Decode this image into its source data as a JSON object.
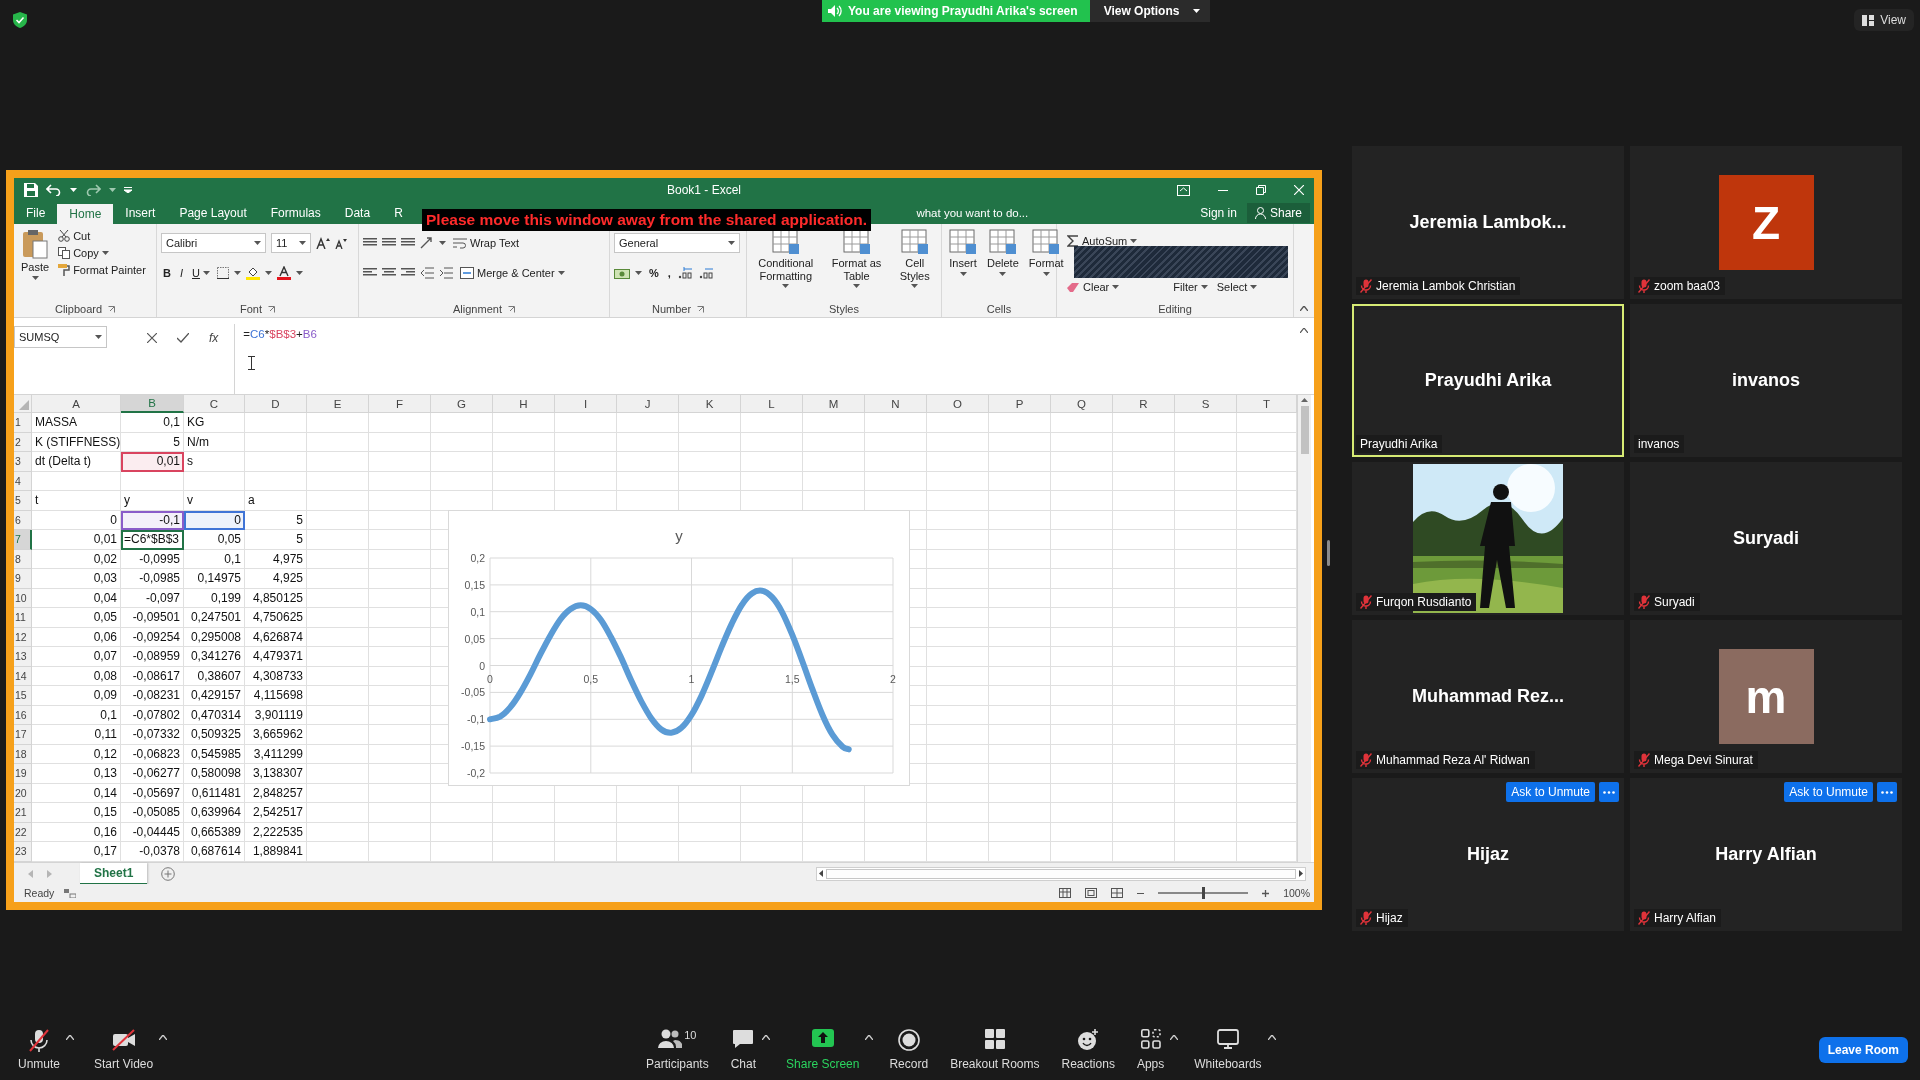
{
  "banner": {
    "text": "You are viewing Prayudhi Arika's screen",
    "button": "View Options"
  },
  "view_button": "View",
  "excel": {
    "title": "Book1 - Excel",
    "tabs": [
      {
        "label": "File",
        "selected": false
      },
      {
        "label": "Home",
        "selected": true
      },
      {
        "label": "Insert",
        "selected": false
      },
      {
        "label": "Page Layout",
        "selected": false
      },
      {
        "label": "Formulas",
        "selected": false
      },
      {
        "label": "Data",
        "selected": false
      },
      {
        "label": "R",
        "selected": false
      }
    ],
    "tell_me": "what you want to do...",
    "sign_in": "Sign in",
    "share": "Share",
    "warning": "Please move this window away from the shared application.",
    "ribbon": [
      {
        "kind": "clipboard",
        "label": "Clipboard",
        "paste": "Paste",
        "items": [
          "Cut",
          "Copy",
          "Format Painter"
        ]
      },
      {
        "kind": "font",
        "label": "Font",
        "font_name": "Calibri",
        "font_size": "11",
        "styles": [
          "B",
          "I",
          "U"
        ]
      },
      {
        "kind": "alignment",
        "label": "Alignment",
        "items": [
          "Wrap Text",
          "Merge & Center"
        ]
      },
      {
        "kind": "number",
        "label": "Number",
        "format": "General",
        "symbols": [
          "%",
          ","
        ]
      },
      {
        "kind": "large_buttons",
        "label": "Styles",
        "items": [
          "Conditional\nFormatting",
          "Format as\nTable",
          "Cell\nStyles"
        ]
      },
      {
        "kind": "large_buttons",
        "label": "Cells",
        "items": [
          "Insert",
          "Delete",
          "Format"
        ]
      },
      {
        "kind": "editing",
        "label": "Editing",
        "items": [
          "AutoSum",
          "Clear",
          "Filter",
          "Select"
        ]
      }
    ],
    "name_box": "SUMSQ",
    "function_button": "fx",
    "formula": [
      {
        "text": "="
      },
      {
        "text": "C6",
        "color": "#3f74d6"
      },
      {
        "text": "*"
      },
      {
        "text": "$B$3",
        "color": "#d9445f"
      },
      {
        "text": "+"
      },
      {
        "text": "B6",
        "color": "#8a5cc9"
      }
    ],
    "columns": [
      {
        "label": "A",
        "selected": false
      },
      {
        "label": "B",
        "selected": true
      },
      {
        "label": "C",
        "selected": false
      },
      {
        "label": "D",
        "selected": false
      },
      {
        "label": "E",
        "selected": false
      },
      {
        "label": "F",
        "selected": false
      },
      {
        "label": "G",
        "selected": false
      },
      {
        "label": "H",
        "selected": false
      },
      {
        "label": "I",
        "selected": false
      },
      {
        "label": "J",
        "selected": false
      },
      {
        "label": "K",
        "selected": false
      },
      {
        "label": "L",
        "selected": false
      },
      {
        "label": "M",
        "selected": false
      },
      {
        "label": "N",
        "selected": false
      },
      {
        "label": "O",
        "selected": false
      },
      {
        "label": "P",
        "selected": false
      },
      {
        "label": "Q",
        "selected": false
      },
      {
        "label": "R",
        "selected": false
      },
      {
        "label": "S",
        "selected": false
      },
      {
        "label": "T",
        "selected": false
      }
    ],
    "rows": [
      {
        "number": "1",
        "selected": false,
        "cells": [
          {
            "text": "MASSA",
            "kind": "text"
          },
          {
            "text": "0,1",
            "kind": "number"
          },
          {
            "text": "KG",
            "kind": "text"
          }
        ]
      },
      {
        "number": "2",
        "selected": false,
        "cells": [
          {
            "text": "K (STIFFNESS)",
            "kind": "text"
          },
          {
            "text": "5",
            "kind": "number"
          },
          {
            "text": "N/m",
            "kind": "text"
          }
        ]
      },
      {
        "number": "3",
        "selected": false,
        "cells": [
          {
            "text": "dt (Delta t)",
            "kind": "text"
          },
          {
            "text": "0,01",
            "kind": "number",
            "color": "#d9445f"
          },
          {
            "text": "s",
            "kind": "text"
          }
        ]
      },
      {
        "number": "4",
        "selected": false
      },
      {
        "number": "5",
        "selected": false,
        "cells": [
          {
            "text": "t",
            "kind": "text"
          },
          {
            "text": "y",
            "kind": "text"
          },
          {
            "text": "v",
            "kind": "text"
          },
          {
            "text": "a",
            "kind": "text"
          }
        ]
      },
      {
        "number": "6",
        "selected": false,
        "cells": [
          {
            "text": "0",
            "kind": "number"
          },
          {
            "text": "-0,1",
            "kind": "number",
            "color": "#8a5cc9"
          },
          {
            "text": "0",
            "kind": "number",
            "color": "#3f74d6"
          },
          {
            "text": "5",
            "kind": "number"
          }
        ]
      },
      {
        "number": "7",
        "selected": true,
        "cells": [
          {
            "text": "0,01",
            "kind": "number"
          },
          {
            "text": "=C6*$B$3",
            "kind": "editing"
          },
          {
            "text": "0,05",
            "kind": "number"
          },
          {
            "text": "5",
            "kind": "number"
          }
        ]
      },
      {
        "number": "8",
        "selected": false,
        "cells": [
          {
            "text": "0,02",
            "kind": "number"
          },
          {
            "text": "-0,0995",
            "kind": "number"
          },
          {
            "text": "0,1",
            "kind": "number"
          },
          {
            "text": "4,975",
            "kind": "number"
          }
        ]
      },
      {
        "number": "9",
        "selected": false,
        "cells": [
          {
            "text": "0,03",
            "kind": "number"
          },
          {
            "text": "-0,0985",
            "kind": "number"
          },
          {
            "text": "0,14975",
            "kind": "number"
          },
          {
            "text": "4,925",
            "kind": "number"
          }
        ]
      },
      {
        "number": "10",
        "selected": false,
        "cells": [
          {
            "text": "0,04",
            "kind": "number"
          },
          {
            "text": "-0,097",
            "kind": "number"
          },
          {
            "text": "0,199",
            "kind": "number"
          },
          {
            "text": "4,850125",
            "kind": "number"
          }
        ]
      },
      {
        "number": "11",
        "selected": false,
        "cells": [
          {
            "text": "0,05",
            "kind": "number"
          },
          {
            "text": "-0,09501",
            "kind": "number"
          },
          {
            "text": "0,247501",
            "kind": "number"
          },
          {
            "text": "4,750625",
            "kind": "number"
          }
        ]
      },
      {
        "number": "12",
        "selected": false,
        "cells": [
          {
            "text": "0,06",
            "kind": "number"
          },
          {
            "text": "-0,09254",
            "kind": "number"
          },
          {
            "text": "0,295008",
            "kind": "number"
          },
          {
            "text": "4,626874",
            "kind": "number"
          }
        ]
      },
      {
        "number": "13",
        "selected": false,
        "cells": [
          {
            "text": "0,07",
            "kind": "number"
          },
          {
            "text": "-0,08959",
            "kind": "number"
          },
          {
            "text": "0,341276",
            "kind": "number"
          },
          {
            "text": "4,479371",
            "kind": "number"
          }
        ]
      },
      {
        "number": "14",
        "selected": false,
        "cells": [
          {
            "text": "0,08",
            "kind": "number"
          },
          {
            "text": "-0,08617",
            "kind": "number"
          },
          {
            "text": "0,38607",
            "kind": "number"
          },
          {
            "text": "4,308733",
            "kind": "number"
          }
        ]
      },
      {
        "number": "15",
        "selected": false,
        "cells": [
          {
            "text": "0,09",
            "kind": "number"
          },
          {
            "text": "-0,08231",
            "kind": "number"
          },
          {
            "text": "0,429157",
            "kind": "number"
          },
          {
            "text": "4,115698",
            "kind": "number"
          }
        ]
      },
      {
        "number": "16",
        "selected": false,
        "cells": [
          {
            "text": "0,1",
            "kind": "number"
          },
          {
            "text": "-0,07802",
            "kind": "number"
          },
          {
            "text": "0,470314",
            "kind": "number"
          },
          {
            "text": "3,901119",
            "kind": "number"
          }
        ]
      },
      {
        "number": "17",
        "selected": false,
        "cells": [
          {
            "text": "0,11",
            "kind": "number"
          },
          {
            "text": "-0,07332",
            "kind": "number"
          },
          {
            "text": "0,509325",
            "kind": "number"
          },
          {
            "text": "3,665962",
            "kind": "number"
          }
        ]
      },
      {
        "number": "18",
        "selected": false,
        "cells": [
          {
            "text": "0,12",
            "kind": "number"
          },
          {
            "text": "-0,06823",
            "kind": "number"
          },
          {
            "text": "0,545985",
            "kind": "number"
          },
          {
            "text": "3,411299",
            "kind": "number"
          }
        ]
      },
      {
        "number": "19",
        "selected": false,
        "cells": [
          {
            "text": "0,13",
            "kind": "number"
          },
          {
            "text": "-0,06277",
            "kind": "number"
          },
          {
            "text": "0,580098",
            "kind": "number"
          },
          {
            "text": "3,138307",
            "kind": "number"
          }
        ]
      },
      {
        "number": "20",
        "selected": false,
        "cells": [
          {
            "text": "0,14",
            "kind": "number"
          },
          {
            "text": "-0,05697",
            "kind": "number"
          },
          {
            "text": "0,611481",
            "kind": "number"
          },
          {
            "text": "2,848257",
            "kind": "number"
          }
        ]
      },
      {
        "number": "21",
        "selected": false,
        "cells": [
          {
            "text": "0,15",
            "kind": "number"
          },
          {
            "text": "-0,05085",
            "kind": "number"
          },
          {
            "text": "0,639964",
            "kind": "number"
          },
          {
            "text": "2,542517",
            "kind": "number"
          }
        ]
      },
      {
        "number": "22",
        "selected": false,
        "cells": [
          {
            "text": "0,16",
            "kind": "number"
          },
          {
            "text": "-0,04445",
            "kind": "number"
          },
          {
            "text": "0,665389",
            "kind": "number"
          },
          {
            "text": "2,222535",
            "kind": "number"
          }
        ]
      },
      {
        "number": "23",
        "selected": false,
        "cells": [
          {
            "text": "0,17",
            "kind": "number"
          },
          {
            "text": "-0,0378",
            "kind": "number"
          },
          {
            "text": "0,687614",
            "kind": "number"
          },
          {
            "text": "1,889841",
            "kind": "number"
          }
        ]
      }
    ],
    "chart_data": {
      "type": "line",
      "title": "y",
      "x": [
        0,
        0.05,
        0.1,
        0.15,
        0.2,
        0.25,
        0.3,
        0.35,
        0.4,
        0.45,
        0.5,
        0.55,
        0.6,
        0.65,
        0.7,
        0.75,
        0.8,
        0.85,
        0.9,
        0.95,
        1,
        1.05,
        1.1,
        1.15,
        1.2,
        1.25,
        1.3,
        1.35,
        1.4,
        1.45,
        1.5,
        1.55,
        1.6,
        1.65,
        1.7,
        1.75,
        1.78
      ],
      "series": [
        {
          "color": "#5b9bd5",
          "values": [
            -0.1,
            -0.095,
            -0.078,
            -0.051,
            -0.017,
            0.021,
            0.056,
            0.086,
            0.105,
            0.112,
            0.105,
            0.085,
            0.053,
            0.015,
            -0.027,
            -0.066,
            -0.098,
            -0.119,
            -0.125,
            -0.116,
            -0.092,
            -0.056,
            -0.012,
            0.035,
            0.078,
            0.113,
            0.134,
            0.139,
            0.127,
            0.099,
            0.057,
            0.008,
            -0.044,
            -0.092,
            -0.129,
            -0.151,
            -0.156
          ]
        }
      ],
      "grid": true,
      "xlim": [
        0,
        2
      ],
      "ylim": [
        -0.2,
        0.2
      ],
      "xticks": [
        {
          "value": 0,
          "label": "0"
        },
        {
          "value": 0.5,
          "label": "0,5"
        },
        {
          "value": 1,
          "label": "1"
        },
        {
          "value": 1.5,
          "label": "1,5"
        },
        {
          "value": 2,
          "label": "2"
        }
      ],
      "yticks": [
        {
          "value": 0.2,
          "label": "0,2"
        },
        {
          "value": 0.15,
          "label": "0,15"
        },
        {
          "value": 0.1,
          "label": "0,1"
        },
        {
          "value": 0.05,
          "label": "0,05"
        },
        {
          "value": 0,
          "label": "0"
        },
        {
          "value": -0.05,
          "label": "-0,05"
        },
        {
          "value": -0.1,
          "label": "-0,1"
        },
        {
          "value": -0.15,
          "label": "-0,15"
        },
        {
          "value": -0.2,
          "label": "-0,2"
        }
      ]
    },
    "sheets": [
      {
        "label": "Sheet1",
        "selected": true
      }
    ],
    "status": "Ready",
    "zoom": {
      "level": 0.5,
      "reading": "100%"
    }
  },
  "gallery": [
    {
      "kind": "name",
      "display_name": "Jeremia Lambok...",
      "label": "Jeremia Lambok Christian",
      "muted": true,
      "speaking": false
    },
    {
      "kind": "avatar",
      "initial": "Z",
      "color": "#bf360c",
      "label": "zoom baa03",
      "muted": true,
      "speaking": false
    },
    {
      "kind": "name",
      "display_name": "Prayudhi Arika",
      "label": "Prayudhi Arika",
      "muted": false,
      "speaking": true
    },
    {
      "kind": "name",
      "display_name": "invanos",
      "label": "invanos",
      "muted": false,
      "speaking": false
    },
    {
      "kind": "picture",
      "label": "Furqon Rusdianto",
      "muted": true,
      "speaking": false
    },
    {
      "kind": "name",
      "display_name": "Suryadi",
      "label": "Suryadi",
      "muted": true,
      "speaking": false
    },
    {
      "kind": "name",
      "display_name": "Muhammad Rez...",
      "label": "Muhammad Reza Al' Ridwan",
      "muted": true,
      "speaking": false
    },
    {
      "kind": "avatar",
      "initial": "m",
      "color": "#8b6b60",
      "label": "Mega Devi Sinurat",
      "muted": true,
      "speaking": false
    },
    {
      "kind": "name",
      "display_name": "Hijaz",
      "label": "Hijaz",
      "muted": true,
      "speaking": false,
      "ask_to_unmute": "Ask to Unmute"
    },
    {
      "kind": "name",
      "display_name": "Harry Alfian",
      "label": "Harry Alfian",
      "muted": true,
      "speaking": false,
      "ask_to_unmute": "Ask to Unmute"
    }
  ],
  "toolbar": {
    "items": [
      {
        "kind": "mic",
        "label": "Unmute",
        "menu": true
      },
      {
        "kind": "video",
        "label": "Start Video",
        "menu": true
      },
      {
        "kind": "participants",
        "label": "Participants",
        "count": "10",
        "menu": false
      },
      {
        "kind": "chat",
        "label": "Chat",
        "menu": true
      },
      {
        "kind": "share",
        "label": "Share Screen",
        "menu": true
      },
      {
        "kind": "record",
        "label": "Record",
        "menu": false
      },
      {
        "kind": "breakout",
        "label": "Breakout Rooms",
        "menu": false
      },
      {
        "kind": "reactions",
        "label": "Reactions",
        "menu": false
      },
      {
        "kind": "apps",
        "label": "Apps",
        "menu": true
      },
      {
        "kind": "whiteboard",
        "label": "Whiteboards",
        "menu": true
      }
    ],
    "leave": "Leave Room"
  }
}
